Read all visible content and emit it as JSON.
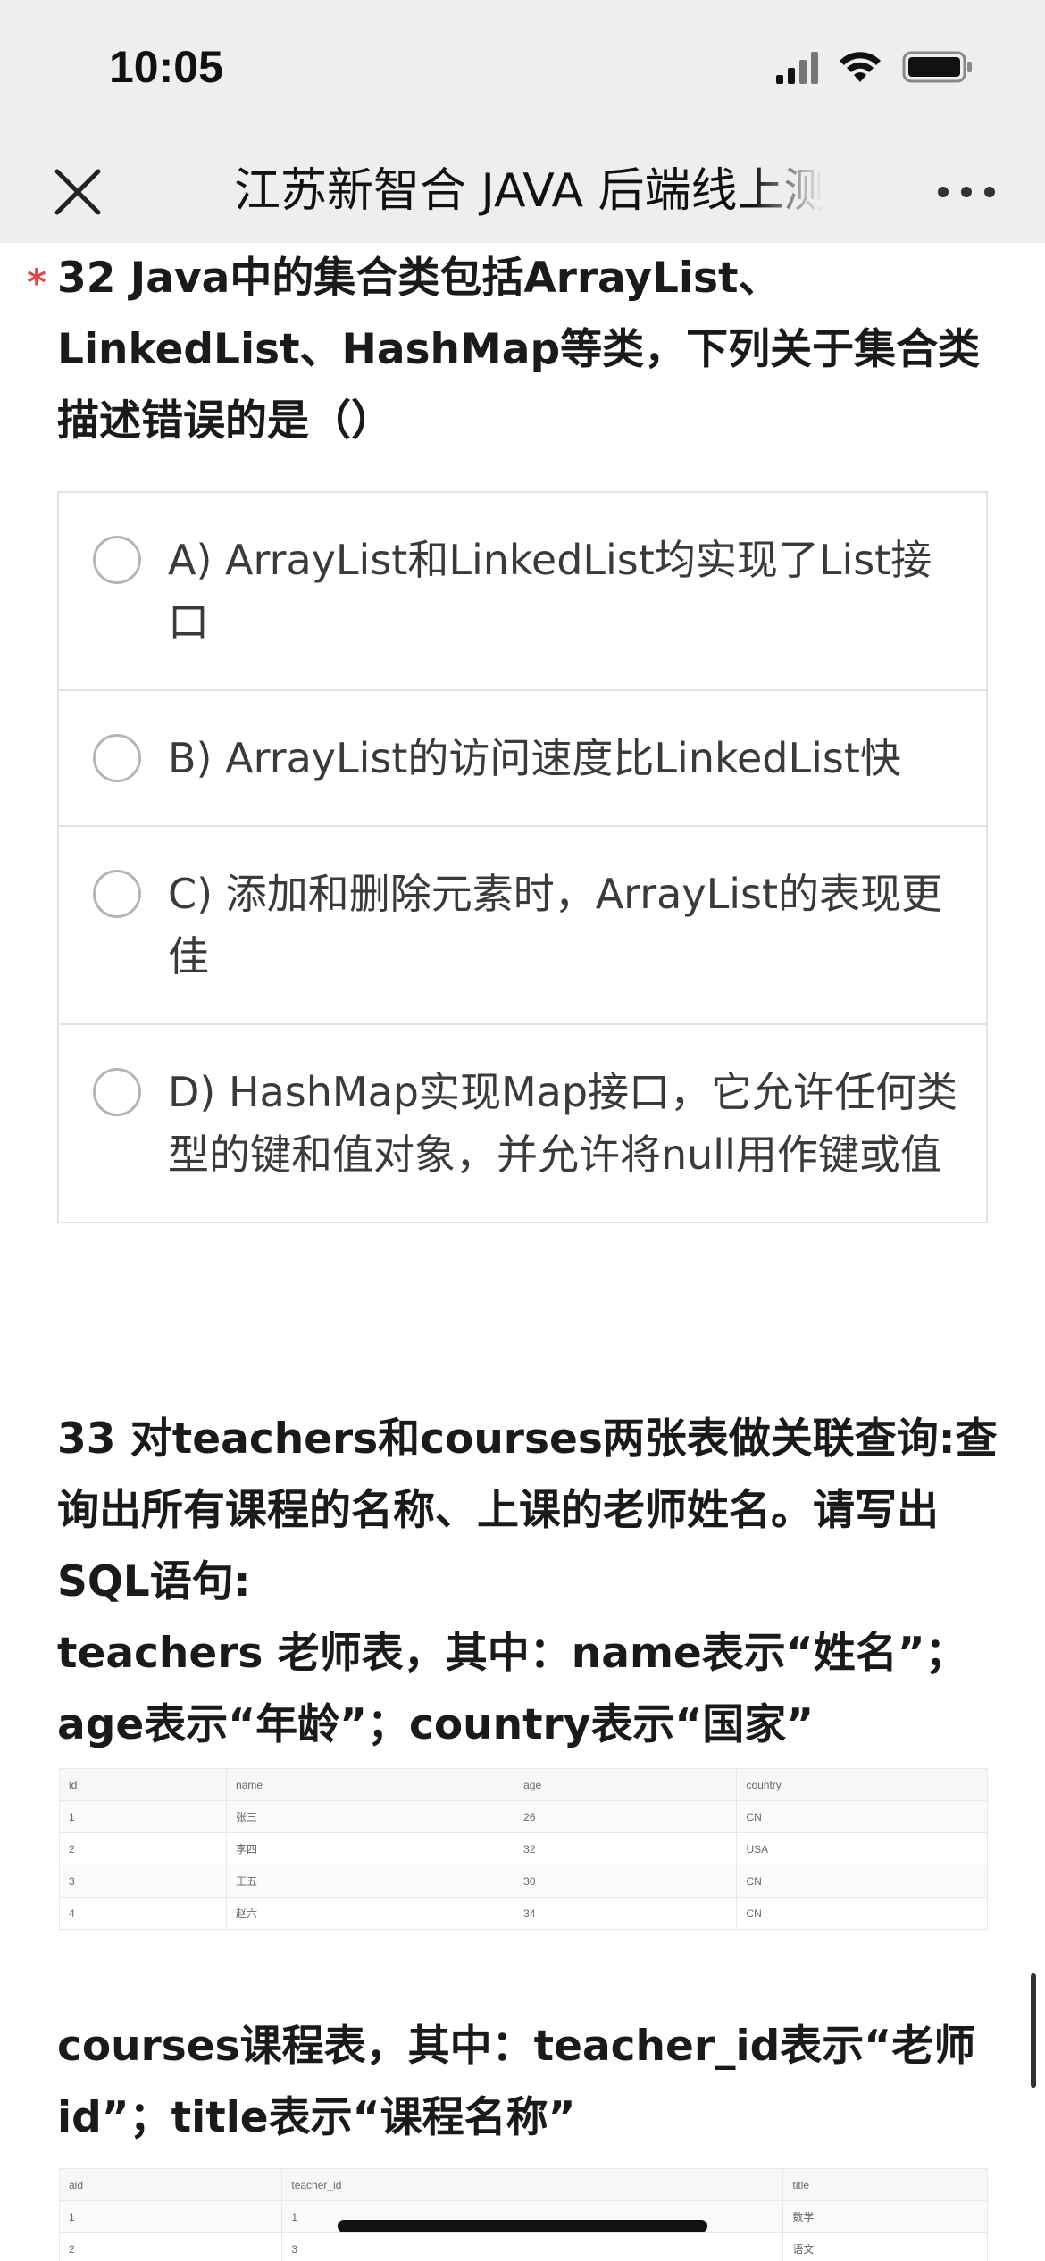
{
  "status_bar": {
    "time": "10:05"
  },
  "nav": {
    "title": "江苏新智合 JAVA 后端线上测"
  },
  "q32": {
    "required_mark": "*",
    "title": "32 Java中的集合类包括ArrayList、LinkedList、HashMap等类，下列关于集合类描述错误的是（）",
    "options": [
      {
        "label": "A) ArrayList和LinkedList均实现了List接口"
      },
      {
        "label": "B) ArrayList的访问速度比LinkedList快"
      },
      {
        "label": "C) 添加和删除元素时，ArrayList的表现更佳"
      },
      {
        "label": "D) HashMap实现Map接口，它允许任何类型的键和值对象，并允许将null用作键或值"
      }
    ]
  },
  "q33": {
    "title": "33 对teachers和courses两张表做关联查询:查询出所有课程的名称、上课的老师姓名。请写出SQL语句:",
    "teachers_desc": "teachers 老师表，其中：name表示“姓名”；age表示“年龄”；country表示“国家”",
    "teachers_table": {
      "headers": [
        "id",
        "name",
        "age",
        "country"
      ],
      "rows": [
        [
          "1",
          "张三",
          "26",
          "CN"
        ],
        [
          "2",
          "李四",
          "32",
          "USA"
        ],
        [
          "3",
          "王五",
          "30",
          "CN"
        ],
        [
          "4",
          "赵六",
          "34",
          "CN"
        ]
      ]
    },
    "courses_desc": "courses课程表，其中：teacher_id表示“老师id”；title表示“课程名称”",
    "courses_table": {
      "headers": [
        "aid",
        "teacher_id",
        "title"
      ],
      "rows": [
        [
          "1",
          "1",
          "数学"
        ],
        [
          "2",
          "3",
          "语文"
        ]
      ]
    }
  }
}
